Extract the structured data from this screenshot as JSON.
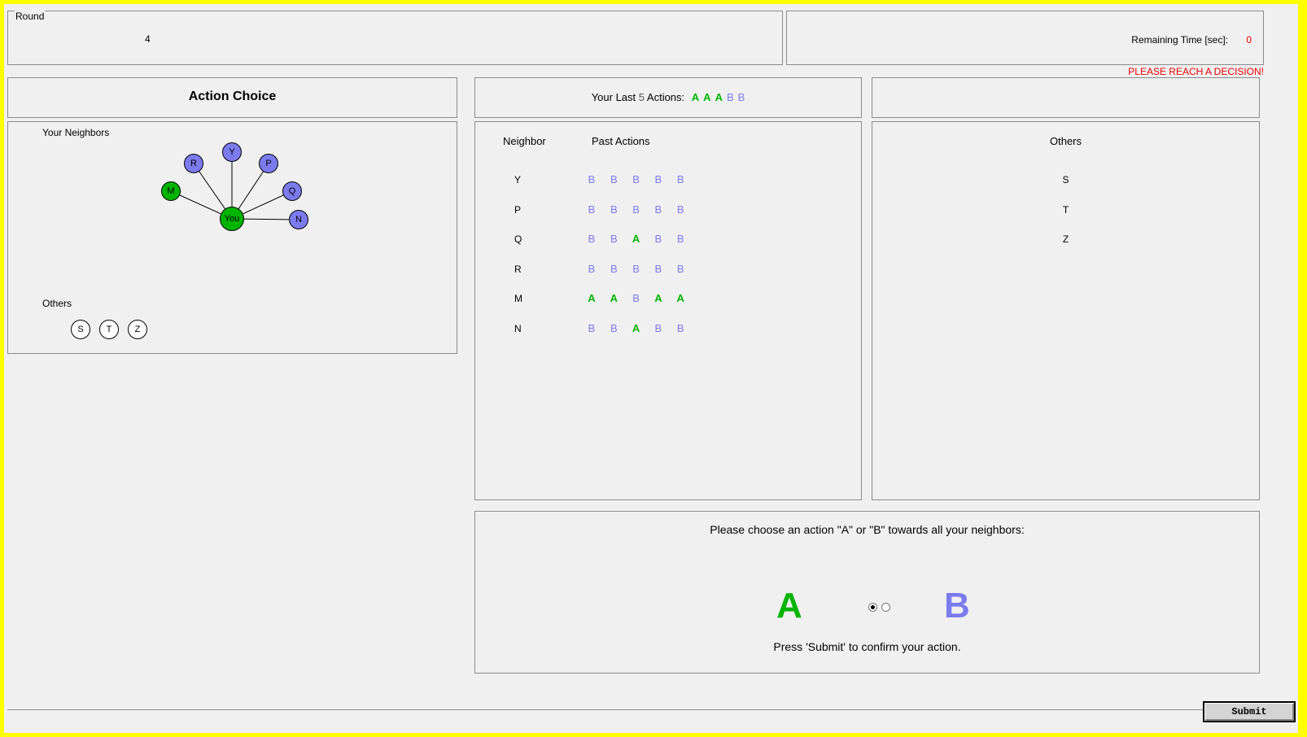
{
  "header": {
    "round_label": "Round",
    "round_value": "4",
    "remaining_time_label": "Remaining Time [sec]:",
    "remaining_time_value": "0",
    "warning": "PLEASE REACH A DECISION!"
  },
  "action_choice": {
    "title": "Action Choice"
  },
  "last_actions": {
    "prefix": "Your Last",
    "count": "5",
    "suffix": "Actions:",
    "actions": [
      "A",
      "A",
      "A",
      "B",
      "B"
    ]
  },
  "graph": {
    "neighbors_label": "Your Neighbors",
    "you_label": "You",
    "neighbors": [
      {
        "name": "R",
        "color": "#7b7bee"
      },
      {
        "name": "Y",
        "color": "#7b7bee"
      },
      {
        "name": "P",
        "color": "#7b7bee"
      },
      {
        "name": "M",
        "color": "#00b400"
      },
      {
        "name": "Q",
        "color": "#7b7bee"
      },
      {
        "name": "N",
        "color": "#7b7bee"
      }
    ],
    "others_label": "Others",
    "others": [
      "S",
      "T",
      "Z"
    ]
  },
  "history": {
    "col_neighbor": "Neighbor",
    "col_past": "Past Actions",
    "rows": [
      {
        "name": "Y",
        "actions": [
          "B",
          "B",
          "B",
          "B",
          "B"
        ]
      },
      {
        "name": "P",
        "actions": [
          "B",
          "B",
          "B",
          "B",
          "B"
        ]
      },
      {
        "name": "Q",
        "actions": [
          "B",
          "B",
          "A",
          "B",
          "B"
        ]
      },
      {
        "name": "R",
        "actions": [
          "B",
          "B",
          "B",
          "B",
          "B"
        ]
      },
      {
        "name": "M",
        "actions": [
          "A",
          "A",
          "B",
          "A",
          "A"
        ]
      },
      {
        "name": "N",
        "actions": [
          "B",
          "B",
          "A",
          "B",
          "B"
        ]
      }
    ]
  },
  "others_panel": {
    "title": "Others",
    "items": [
      "S",
      "T",
      "Z"
    ]
  },
  "choice": {
    "prompt": "Please choose an action \"A\" or \"B\"  towards all your neighbors:",
    "option_a": "A",
    "option_b": "B",
    "selected": "A",
    "confirm": "Press 'Submit' to confirm your action."
  },
  "submit_label": "Submit",
  "colors": {
    "action_a": "#00b400",
    "action_b": "#7b7bee",
    "alert": "#ee0000"
  }
}
